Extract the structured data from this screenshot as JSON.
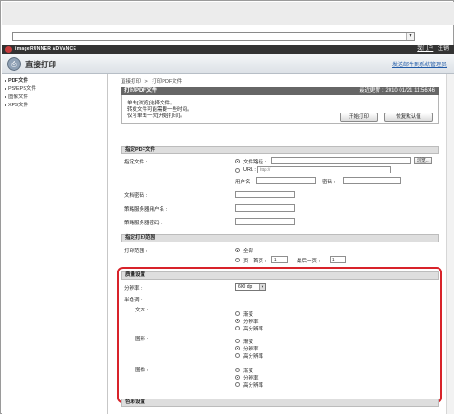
{
  "window": {
    "address_dropdown_icon": "chevron-down-icon"
  },
  "brand": {
    "name": "imageRUNNER ADVANCE",
    "my_page": "我门户",
    "logout": "注销"
  },
  "header": {
    "title": "直接打印",
    "admin_link": "发送邮件到系统管理员"
  },
  "sidebar": {
    "items": [
      {
        "label": "PDF文件",
        "active": true
      },
      {
        "label": "PS/EPS文件",
        "active": false
      },
      {
        "label": "图像文件",
        "active": false
      },
      {
        "label": "XPS文件",
        "active": false
      }
    ]
  },
  "breadcrumb": {
    "root": "直接打印",
    "current": "打印PDF文件",
    "separator": ">"
  },
  "panel": {
    "title": "打印PDF文件",
    "updated": "最近更新 : 2010 01/21 11:56:46",
    "instructions": [
      "单击[浏览]选择文件。",
      "转发文件可能需要一些时间。",
      "仅可单击一次[开始打印]。"
    ],
    "start_button": "开始打印",
    "reset_button": "恢复默认值"
  },
  "file_section": {
    "title": "指定PDF文件",
    "specify_file_label": "指定文件 :",
    "file_path_label": "文件路径 :",
    "browse_button": "浏览...",
    "url_label": "URL :",
    "url_placeholder": "http://",
    "username_label": "用户名 :",
    "password_label": "密码 :",
    "doc_password_label": "文档密码 :",
    "policy_user_label": "策略服务器用户名 :",
    "policy_password_label": "策略服务器密码 :"
  },
  "range_section": {
    "title": "指定打印范围",
    "range_label": "打印范围 :",
    "all_label": "全部",
    "pages_label": "页",
    "first_page_label": "首页 :",
    "first_page_value": "1",
    "last_page_label": "最后一页 :",
    "last_page_value": "1"
  },
  "quality_section": {
    "title": "质量设置",
    "resolution_label": "分辨率 :",
    "resolution_value": "600 dpi",
    "halftone_label": "半色调 :",
    "groups": [
      {
        "label": "文本 :",
        "options": [
          "渐变",
          "分辨率",
          "高分辨率"
        ],
        "selected": 1
      },
      {
        "label": "图形 :",
        "options": [
          "渐变",
          "分辨率",
          "高分辨率"
        ],
        "selected": 1
      },
      {
        "label": "图像 :",
        "options": [
          "渐变",
          "分辨率",
          "高分辨率"
        ],
        "selected": 1
      }
    ]
  },
  "color_section": {
    "title": "色彩设置"
  },
  "colors": {
    "highlight": "#d8232a",
    "panel_header": "#666666",
    "section_header": "#dedede"
  }
}
